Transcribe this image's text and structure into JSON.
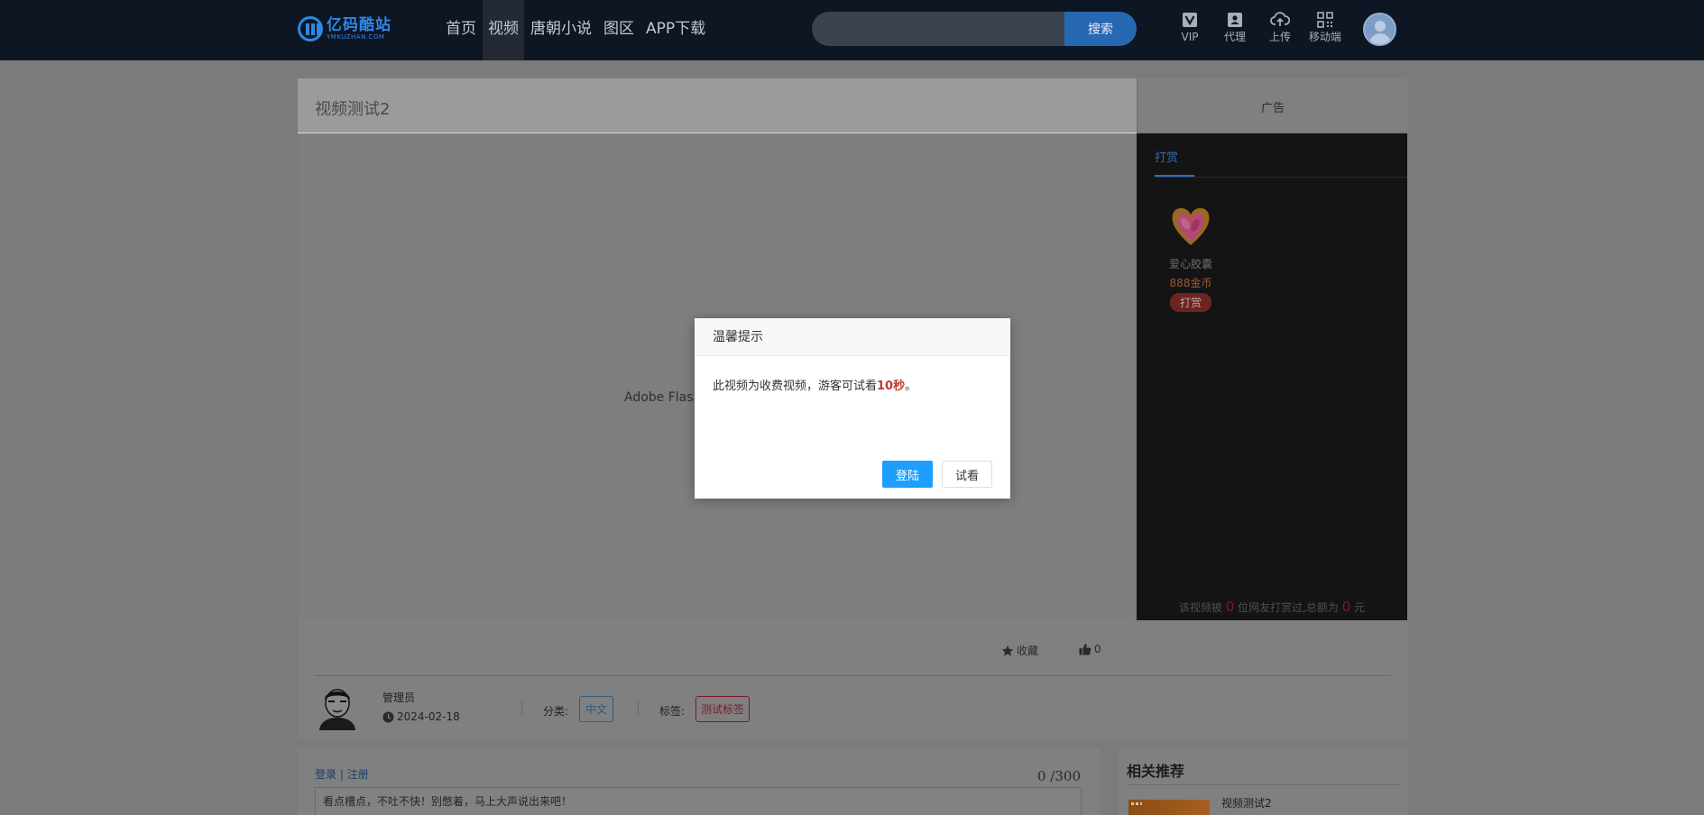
{
  "header": {
    "logo": {
      "cn": "亿码酷站",
      "en": "YMKUZHAN.COM"
    },
    "nav": [
      {
        "label": "首页"
      },
      {
        "label": "视频"
      },
      {
        "label": "唐朝小说"
      },
      {
        "label": "图区"
      },
      {
        "label": "APP下载"
      }
    ],
    "search": {
      "value": "",
      "placeholder": "",
      "button": "搜索"
    },
    "tools": [
      {
        "label": "VIP",
        "icon": "vip-icon"
      },
      {
        "label": "代理",
        "icon": "agent-icon"
      },
      {
        "label": "上传",
        "icon": "upload-cloud-icon"
      },
      {
        "label": "移动端",
        "icon": "qrcode-icon"
      }
    ]
  },
  "video": {
    "title": "视频测试2",
    "flash_notice": "Adobe Flash"
  },
  "sidebar": {
    "ad_label": "广告",
    "reward_tab": "打赏",
    "gift": {
      "name": "爱心胶囊",
      "price": "888金币",
      "button": "打赏"
    },
    "stat": {
      "prefix": "该视频被",
      "count": "0",
      "middle": "位网友打赏过,总额为",
      "amount": "0",
      "suffix": "元"
    }
  },
  "info": {
    "favorite": "收藏",
    "likes": "0",
    "author": "管理员",
    "date": "2024-02-18",
    "category_label": "分类:",
    "category": "中文",
    "tag_label": "标签:",
    "tag": "测试标签"
  },
  "comment": {
    "login": "登录",
    "divider": "|",
    "register": "注册",
    "counter": "0 /300",
    "placeholder": "看点槽点，不吐不快！别憋着，马上大声说出来吧！"
  },
  "recommend": {
    "title": "相关推荐",
    "items": [
      {
        "name": "视频测试2"
      }
    ]
  },
  "modal": {
    "title": "温馨提示",
    "message_prefix": "此视频为收费视频，游客可试看",
    "highlight": "10秒",
    "message_suffix": "。",
    "confirm": "登陆",
    "cancel": "试看"
  },
  "colors": {
    "header_bg": "#0e1623",
    "brand_blue": "#2f87e6",
    "search_button": "#2768b3",
    "modal_primary": "#1e9fff",
    "highlight_red": "#c0392b"
  }
}
